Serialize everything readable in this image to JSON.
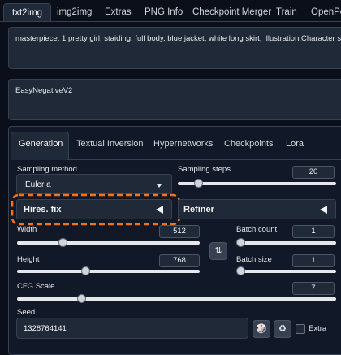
{
  "top_tabs": [
    "txt2img",
    "img2img",
    "Extras",
    "PNG Info",
    "Checkpoint Merger",
    "Train",
    "OpenPos"
  ],
  "prompt": "masterpiece, 1 pretty girl, staiding, full body, blue jacket, white long skirt, Illustration,Character setting table",
  "negative_prompt": "EasyNegativeV2",
  "sub_tabs": [
    "Generation",
    "Textual Inversion",
    "Hypernetworks",
    "Checkpoints",
    "Lora"
  ],
  "sampling": {
    "method_label": "Sampling method",
    "method_value": "Euler a",
    "steps_label": "Sampling steps",
    "steps_value": "20",
    "steps_fraction": 0.13
  },
  "hires": {
    "label": "Hires. fix"
  },
  "refiner": {
    "label": "Refiner"
  },
  "width": {
    "label": "Width",
    "value": "512",
    "fraction": 0.25
  },
  "height": {
    "label": "Height",
    "value": "768",
    "fraction": 0.375
  },
  "batch_count": {
    "label": "Batch count",
    "value": "1",
    "fraction": 0.0
  },
  "batch_size": {
    "label": "Batch size",
    "value": "1",
    "fraction": 0.0
  },
  "cfg": {
    "label": "CFG Scale",
    "value": "7",
    "fraction": 0.2
  },
  "seed": {
    "label": "Seed",
    "value": "1328764141"
  },
  "extra": {
    "label": "Extra"
  },
  "colors": {
    "highlight": "#f97316"
  }
}
